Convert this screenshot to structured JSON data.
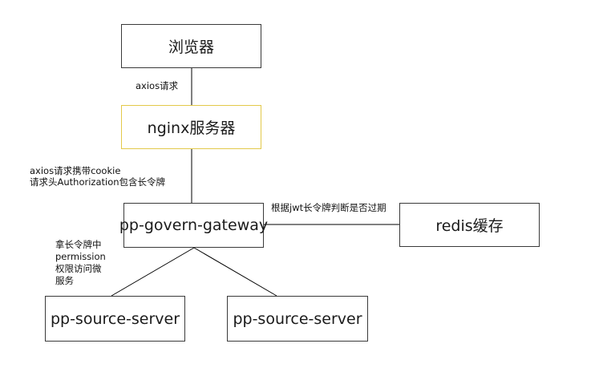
{
  "nodes": {
    "browser": "浏览器",
    "nginx": "nginx服务器",
    "gateway": "pp-govern-gateway",
    "redis": "redis缓存",
    "source_left": "pp-source-server",
    "source_right": "pp-source-server"
  },
  "edge_labels": {
    "browser_nginx": "axios请求",
    "nginx_gateway_line1": "axios请求携带cookie",
    "nginx_gateway_line2": "请求头Authorization包含长令牌",
    "gateway_redis": "根据jwt长令牌判断是否过期",
    "gateway_sources_line1": "拿长令牌中",
    "gateway_sources_line2": "permission",
    "gateway_sources_line3": "权限访问微",
    "gateway_sources_line4": "服务"
  },
  "colors": {
    "node_border": "#3a3a3a",
    "nginx_border": "#e3c94a",
    "edge": "#000000"
  }
}
